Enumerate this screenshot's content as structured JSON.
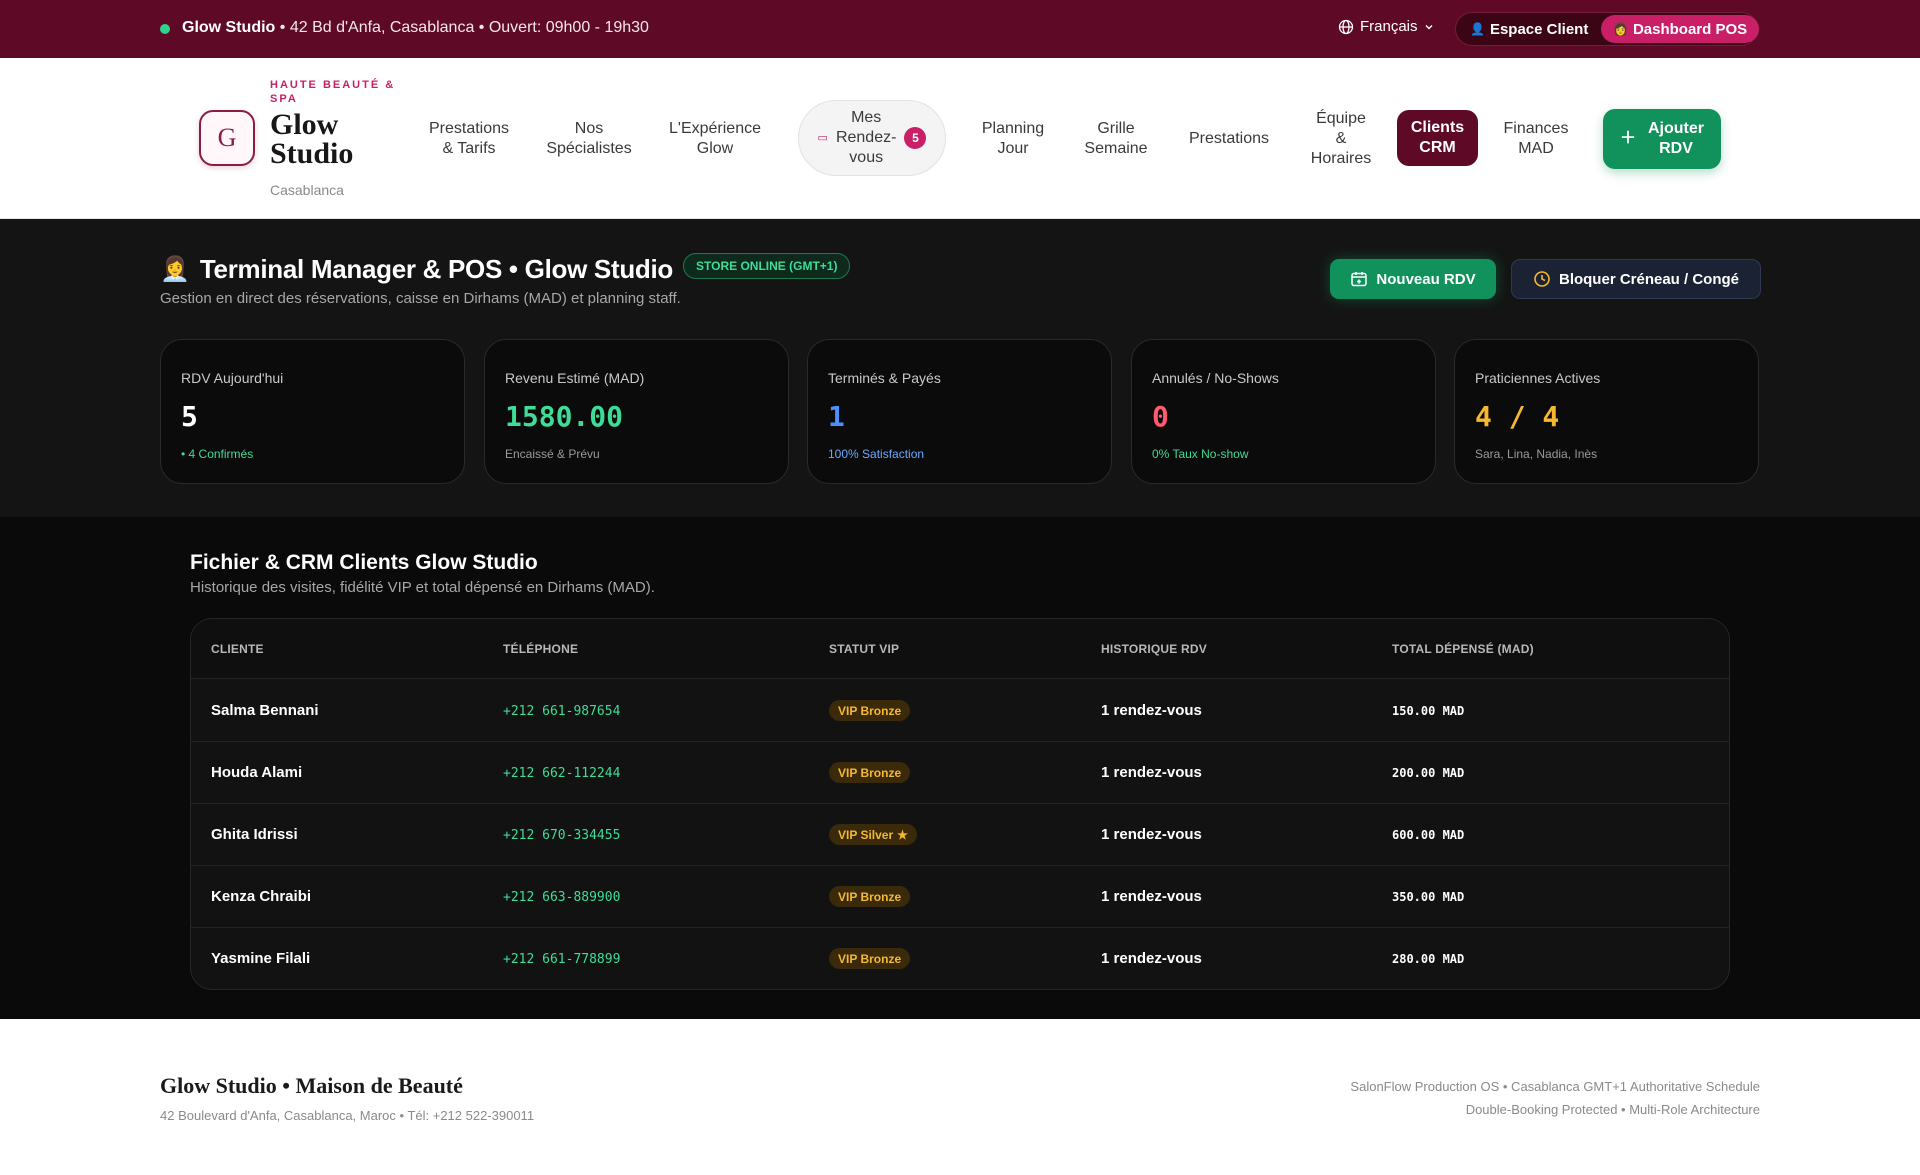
{
  "colors": {
    "brand": "#5e0a26",
    "accent": "#c81f66",
    "success": "#11915b",
    "online": "#3ddc97"
  },
  "topbar": {
    "studio": "Glow Studio",
    "details": " • 42 Bd d'Anfa, Casablanca • Ouvert: 09h00 - 19h30",
    "language": "Français",
    "role_client": "Espace Client",
    "role_pos": "Dashboard POS"
  },
  "brand": {
    "initial": "G",
    "tagline": "HAUTE BEAUTÉ & SPA",
    "name": "Glow Studio",
    "city": "Casablanca"
  },
  "nav": {
    "prestations_tarifs": [
      "Prestations",
      "& Tarifs"
    ],
    "specialistes": [
      "Nos",
      "Spécialistes"
    ],
    "experience": [
      "L'Expérience",
      "Glow"
    ],
    "rdv": [
      "Mes",
      "Rendez-",
      "vous"
    ],
    "rdv_badge": "5",
    "planning": [
      "Planning",
      "Jour"
    ],
    "grille": [
      "Grille",
      "Semaine"
    ],
    "prestations": "Prestations",
    "equipe": [
      "Équipe",
      "&",
      "Horaires"
    ],
    "clients": [
      "Clients",
      "CRM"
    ],
    "finances": [
      "Finances",
      "MAD"
    ],
    "add": [
      "Ajouter",
      "RDV"
    ]
  },
  "dashboard": {
    "emoji": "👩‍💼",
    "title": "Terminal Manager & POS • Glow Studio",
    "status": "STORE ONLINE (GMT+1)",
    "subtitle": "Gestion en direct des réservations, caisse en Dirhams (MAD) et planning staff.",
    "new_rdv": "Nouveau RDV",
    "block_slot": "Bloquer Créneau / Congé",
    "cards": [
      {
        "label": "RDV Aujourd'hui",
        "value": "5",
        "foot": "• 4 Confirmés",
        "value_color": "#ffffff",
        "foot_color": "#3ddc97"
      },
      {
        "label": "Revenu Estimé (MAD)",
        "value": "1580.00",
        "foot": "Encaissé & Prévu",
        "value_color": "#3ddc97",
        "foot_color": "#9a9a9a"
      },
      {
        "label": "Terminés & Payés",
        "value": "1",
        "foot": "100% Satisfaction",
        "value_color": "#4a90ff",
        "foot_color": "#6aa8ff"
      },
      {
        "label": "Annulés / No-Shows",
        "value": "0",
        "foot": "0% Taux No-show",
        "value_color": "#ff5a6e",
        "foot_color": "#3ddc97"
      },
      {
        "label": "Praticiennes Actives",
        "value": "4 / 4",
        "foot": "Sara, Lina, Nadia, Inès",
        "value_color": "#f5b82e",
        "foot_color": "#9a9a9a"
      }
    ]
  },
  "crm": {
    "title": "Fichier & CRM Clients Glow Studio",
    "subtitle": "Historique des visites, fidélité VIP et total dépensé en Dirhams (MAD).",
    "columns": [
      "CLIENTE",
      "TÉLÉPHONE",
      "STATUT VIP",
      "HISTORIQUE RDV",
      "TOTAL DÉPENSÉ (MAD)"
    ],
    "rows": [
      {
        "name": "Salma Bennani",
        "phone": "+212 661-987654",
        "vip": "VIP Bronze",
        "star": false,
        "history": "1 rendez-vous",
        "total": "150.00 MAD"
      },
      {
        "name": "Houda Alami",
        "phone": "+212 662-112244",
        "vip": "VIP Bronze",
        "star": false,
        "history": "1 rendez-vous",
        "total": "200.00 MAD"
      },
      {
        "name": "Ghita Idrissi",
        "phone": "+212 670-334455",
        "vip": "VIP Silver",
        "star": true,
        "history": "1 rendez-vous",
        "total": "600.00 MAD"
      },
      {
        "name": "Kenza Chraibi",
        "phone": "+212 663-889900",
        "vip": "VIP Bronze",
        "star": false,
        "history": "1 rendez-vous",
        "total": "350.00 MAD"
      },
      {
        "name": "Yasmine Filali",
        "phone": "+212 661-778899",
        "vip": "VIP Bronze",
        "star": false,
        "history": "1 rendez-vous",
        "total": "280.00 MAD"
      }
    ]
  },
  "footer": {
    "title": "Glow Studio • Maison de Beauté",
    "address": "42 Boulevard d'Anfa, Casablanca, Maroc • Tél: +212 522-390011",
    "right1": "SalonFlow Production OS • Casablanca GMT+1 Authoritative Schedule",
    "right2": "Double-Booking Protected • Multi-Role Architecture"
  }
}
